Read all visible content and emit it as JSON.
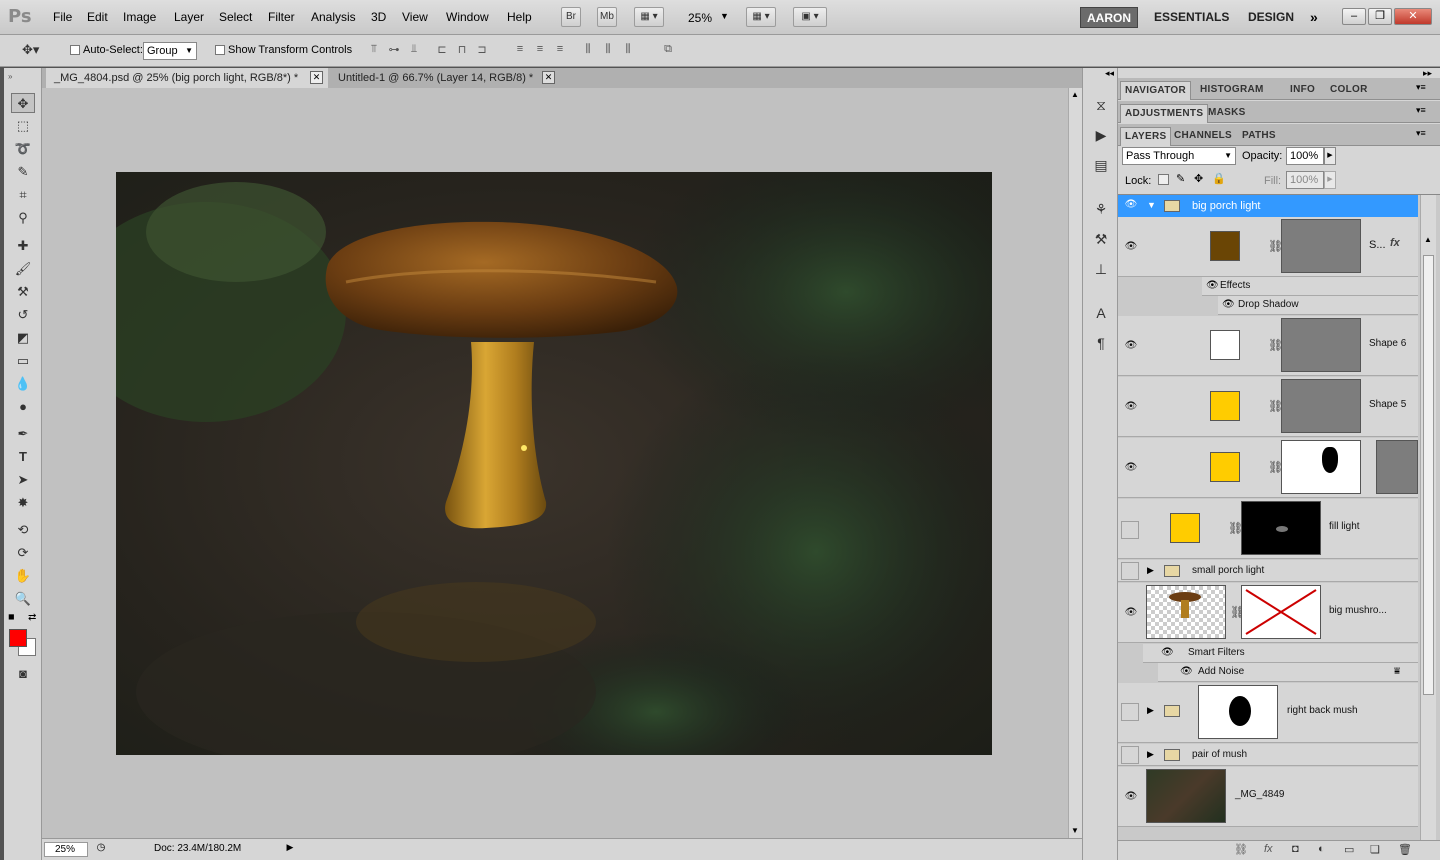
{
  "app": {
    "logo": "Ps"
  },
  "menu": [
    "File",
    "Edit",
    "Image",
    "Layer",
    "Select",
    "Filter",
    "Analysis",
    "3D",
    "View",
    "Window",
    "Help"
  ],
  "menubar_buttons": {
    "br": "Br",
    "mb": "Mb",
    "zoom": "25%"
  },
  "workspaces": [
    "AARON",
    "ESSENTIALS",
    "DESIGN"
  ],
  "options": {
    "auto_select_label": "Auto-Select:",
    "auto_select_value": "Group",
    "show_transform_label": "Show Transform Controls"
  },
  "tabs": [
    {
      "label": "_MG_4804.psd @ 25% (big porch light, RGB/8*) *",
      "active": true
    },
    {
      "label": "Untitled-1 @ 66.7% (Layer 14, RGB/8) *",
      "active": false
    }
  ],
  "status": {
    "zoom": "25%",
    "doc": "Doc: 23.4M/180.2M"
  },
  "panel_groups": {
    "top": [
      "NAVIGATOR",
      "HISTOGRAM",
      "INFO",
      "COLOR"
    ],
    "mid": [
      "ADJUSTMENTS",
      "MASKS"
    ],
    "layers": [
      "LAYERS",
      "CHANNELS",
      "PATHS"
    ]
  },
  "layers_panel": {
    "blend_mode": "Pass Through",
    "opacity_label": "Opacity:",
    "opacity_value": "100%",
    "lock_label": "Lock:",
    "fill_label": "Fill:",
    "fill_value": "100%",
    "rows": {
      "group_big": "big porch light",
      "shape_s": "S...",
      "effects": "Effects",
      "drop_shadow": "Drop Shadow",
      "shape6": "Shape 6",
      "shape5": "Shape 5",
      "fill_light": "fill light",
      "small_porch": "small porch light",
      "big_mush": "big mushro...",
      "smart_filters": "Smart Filters",
      "add_noise": "Add Noise",
      "right_back": "right back mush",
      "pair_mush": "pair of mush",
      "mg4849": "_MG_4849"
    }
  },
  "colors": {
    "foreground": "#ff0000",
    "background": "#ffffff",
    "selection": "#3399ff"
  }
}
